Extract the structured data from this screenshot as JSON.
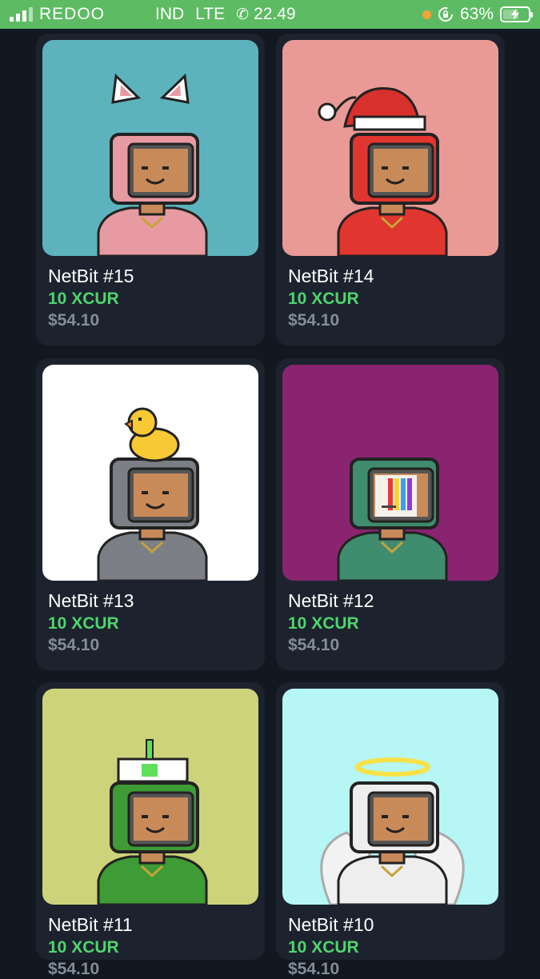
{
  "status_bar": {
    "carrier": "REDOO",
    "network_left": "IND",
    "network_type": "LTE",
    "time": "22.49",
    "battery": "63%",
    "battery_level": 0.63,
    "icons": [
      "signal-icon",
      "phone-icon",
      "orange-dot-icon",
      "rotation-lock-icon",
      "battery-charging-icon"
    ]
  },
  "colors": {
    "status_bar_bg": "#5dbb63",
    "page_bg": "#121820",
    "card_bg": "#1c232e",
    "price_green": "#4fd46e",
    "usd_grey": "#838c99"
  },
  "items": [
    {
      "name": "NetBit #15",
      "price": "10 XCUR",
      "usd": "$54.10",
      "bg": "#5cb3bd",
      "body": "#e89aa2",
      "accessory": "cat-ears"
    },
    {
      "name": "NetBit #14",
      "price": "10 XCUR",
      "usd": "$54.10",
      "bg": "#e99a97",
      "body": "#e0362f",
      "accessory": "santa-hat"
    },
    {
      "name": "NetBit #13",
      "price": "10 XCUR",
      "usd": "$54.10",
      "bg": "#ffffff",
      "body": "#7c7f86",
      "accessory": "rubber-duck"
    },
    {
      "name": "NetBit #12",
      "price": "10 XCUR",
      "usd": "$54.10",
      "bg": "#8a2470",
      "body": "#3f8c6e",
      "accessory": "glitch-screen"
    },
    {
      "name": "NetBit #11",
      "price": "10 XCUR",
      "usd": "$54.10",
      "bg": "#cdd37a",
      "body": "#3e9b36",
      "accessory": "antenna-cap"
    },
    {
      "name": "NetBit #10",
      "price": "10 XCUR",
      "usd": "$54.10",
      "bg": "#b6f6f5",
      "body": "#eeeeee",
      "accessory": "halo-wings"
    }
  ]
}
